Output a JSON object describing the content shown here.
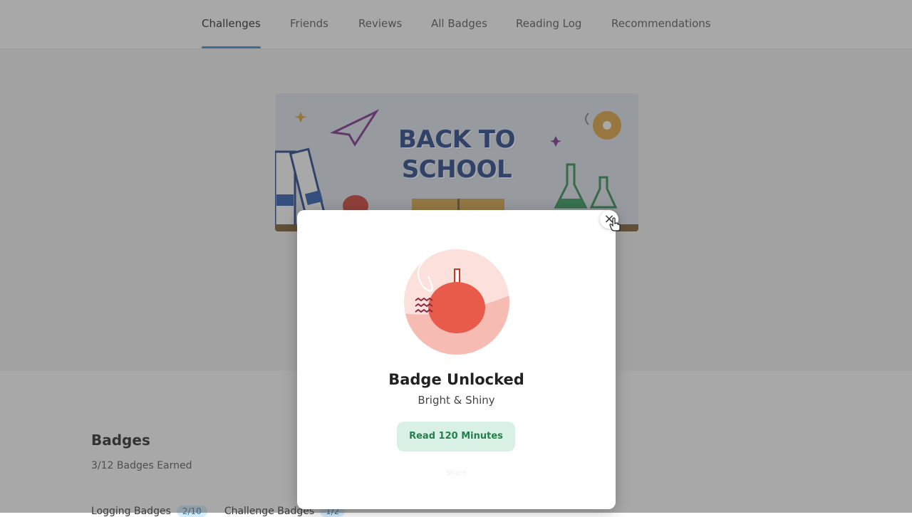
{
  "nav": {
    "tabs": [
      {
        "label": "Challenges",
        "active": true
      },
      {
        "label": "Friends",
        "active": false
      },
      {
        "label": "Reviews",
        "active": false
      },
      {
        "label": "All Badges",
        "active": false
      },
      {
        "label": "Reading Log",
        "active": false
      },
      {
        "label": "Recommendations",
        "active": false
      }
    ]
  },
  "banner": {
    "title_line1": "BACK TO",
    "title_line2": "SCHOOL"
  },
  "badges": {
    "heading": "Badges",
    "earned": "3/12 Badges Earned",
    "subtabs": [
      {
        "label": "Logging Badges",
        "count": "2/10"
      },
      {
        "label": "Challenge Badges",
        "count": "1/2"
      }
    ]
  },
  "modal": {
    "close_label": "×",
    "badge_icon": "apple-badge-icon",
    "title": "Badge Unlocked",
    "subtitle": "Bright & Shiny",
    "goal": "Read 120 Minutes",
    "footer": "Share"
  },
  "colors": {
    "accent": "#3a8fd6",
    "goal_bg": "#d9f1e4",
    "goal_text": "#23804c",
    "apple_red": "#e85a4a"
  }
}
